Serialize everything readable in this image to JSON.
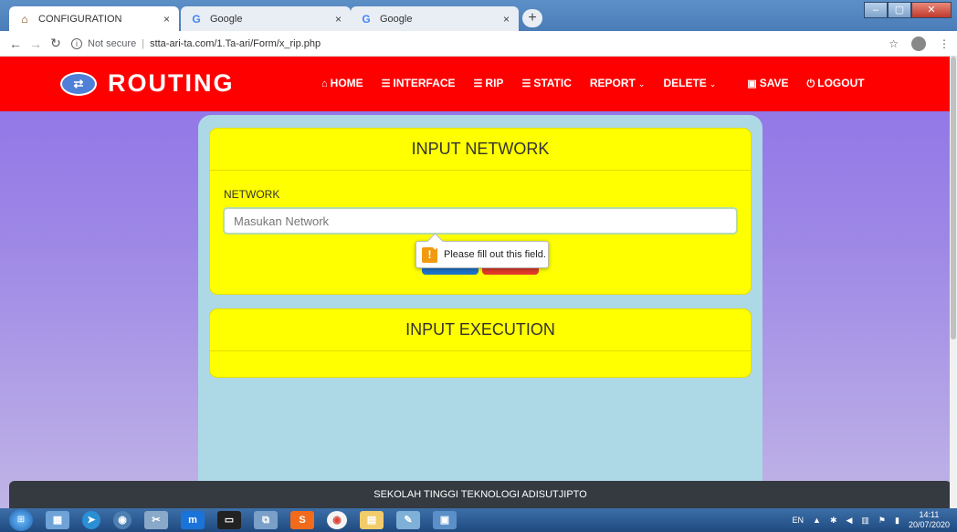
{
  "browser": {
    "tabs": [
      {
        "title": "CONFIGURATION",
        "close": "×"
      },
      {
        "title": "Google",
        "close": "×"
      },
      {
        "title": "Google",
        "close": "×"
      }
    ],
    "new_tab": "+",
    "window_buttons": {
      "minimize": "–",
      "maximize": "▢",
      "close": "✕"
    },
    "security": "Not secure",
    "url": "stta-ari-ta.com/1.Ta-ari/Form/x_rip.php"
  },
  "navbar": {
    "brand": "ROUTING",
    "items": [
      {
        "icon": "⌂",
        "label": "HOME"
      },
      {
        "icon": "☰",
        "label": "INTERFACE"
      },
      {
        "icon": "☰",
        "label": "RIP"
      },
      {
        "icon": "☰",
        "label": "STATIC"
      },
      {
        "icon": "",
        "label": "REPORT",
        "caret": "⌄"
      },
      {
        "icon": "",
        "label": "DELETE",
        "caret": "⌄"
      },
      {
        "icon": "▣",
        "label": "SAVE"
      },
      {
        "icon": "⏻",
        "label": "LOGOUT"
      }
    ]
  },
  "form": {
    "title": "INPUT NETWORK",
    "field_label": "NETWORK",
    "field_placeholder": "Masukan Network",
    "field_value": "",
    "validation_message": "Please fill out this field.",
    "warning_glyph": "!"
  },
  "execution": {
    "title": "INPUT EXECUTION"
  },
  "footer": {
    "text": "SEKOLAH TINGGI TEKNOLOGI ADISUTJIPTO"
  },
  "taskbar": {
    "language": "EN",
    "time": "14:11",
    "date": "20/07/2020"
  },
  "colors": {
    "navbar": "#ff0000",
    "card": "#ffff00",
    "panel": "#add8e6",
    "footer": "#343a40",
    "button_primary": "#1e73c8",
    "button_danger": "#e03a2b"
  }
}
